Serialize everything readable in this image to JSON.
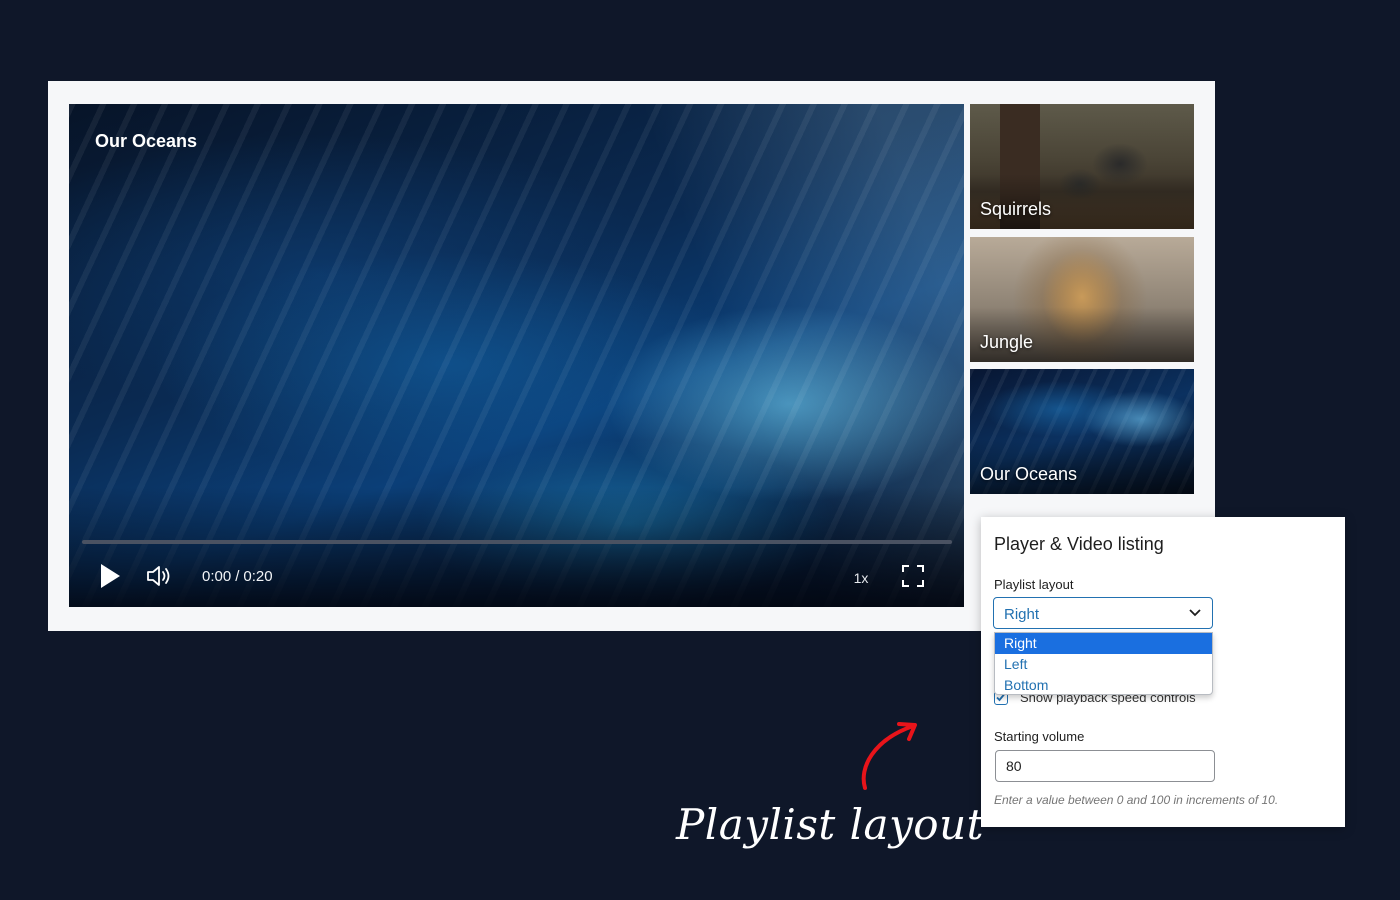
{
  "player": {
    "title": "Our Oceans",
    "time_current": "0:00",
    "time_separator": "/",
    "time_total": "0:20",
    "playback_speed": "1x",
    "progress_fraction": 0
  },
  "playlist": {
    "items": [
      {
        "label": "Squirrels"
      },
      {
        "label": "Jungle"
      },
      {
        "label": "Our Oceans"
      }
    ]
  },
  "settings": {
    "title": "Player & Video listing",
    "layout_label": "Playlist layout",
    "layout_selected": "Right",
    "layout_options": [
      "Right",
      "Left",
      "Bottom"
    ],
    "speed_checkbox_label": "Show playback speed controls",
    "speed_checkbox_checked": true,
    "volume_label": "Starting volume",
    "volume_value": "80",
    "volume_help": "Enter a value between 0 and 100 in increments of 10."
  },
  "annotation": {
    "text": "Playlist layout"
  },
  "colors": {
    "page_background": "#0f1729",
    "accent": "#2271b1",
    "selected_option": "#1a6fe0",
    "annotation_arrow": "#e8141a"
  },
  "icons": {
    "play": "play-icon",
    "volume": "volume-icon",
    "fullscreen": "fullscreen-icon",
    "chevron": "chevron-down-icon",
    "checkmark": "checkmark-icon",
    "arrow": "curved-arrow-icon"
  }
}
